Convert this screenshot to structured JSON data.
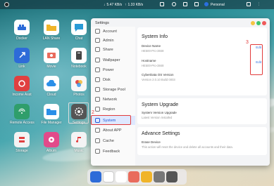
{
  "topbar": {
    "down_speed": "5.47 KB/s",
    "up_speed": "1.33 KB/s",
    "user": "Personal"
  },
  "desktop": {
    "icons": [
      {
        "label": "Docker",
        "icon": "docker-icon",
        "color": "#2d6bd8"
      },
      {
        "label": "LAN Share",
        "icon": "folder-share-icon",
        "color": "#f0b429"
      },
      {
        "label": "Chat",
        "icon": "chat-icon",
        "color": "#2a9bd6"
      },
      {
        "label": "Link",
        "icon": "link-icon",
        "color": "#2d6bd8"
      },
      {
        "label": "Movie",
        "icon": "movie-icon",
        "color": "#e96b5c"
      },
      {
        "label": "Notebook",
        "icon": "notebook-icon",
        "color": "#444"
      },
      {
        "label": "Income Asst",
        "icon": "income-icon",
        "color": "#e04040"
      },
      {
        "label": "Cloud",
        "icon": "cloud-icon",
        "color": "#2a8fe8"
      },
      {
        "label": "Photos",
        "icon": "photos-icon",
        "color": "#f7f7f7"
      },
      {
        "label": "Remote Access",
        "icon": "remote-icon",
        "color": "#2f9e6b"
      },
      {
        "label": "File Manager",
        "icon": "folder-icon",
        "color": "#2a8fe8"
      },
      {
        "label": "Settings",
        "icon": "gear-icon",
        "color": "#555"
      },
      {
        "label": "Storage",
        "icon": "storage-icon",
        "color": "#f3f3f3"
      },
      {
        "label": "Album",
        "icon": "album-icon",
        "color": "#e24a8a"
      },
      {
        "label": "Music",
        "icon": "music-icon",
        "color": "#f4f4f4"
      }
    ]
  },
  "window": {
    "title": "Settings"
  },
  "sidebar": {
    "items": [
      {
        "label": "Account",
        "icon": "account-icon"
      },
      {
        "label": "Admin",
        "icon": "admin-icon"
      },
      {
        "label": "Share",
        "icon": "share-icon"
      },
      {
        "label": "Wallpaper",
        "icon": "wallpaper-icon"
      },
      {
        "label": "Power",
        "icon": "power-icon"
      },
      {
        "label": "Disk",
        "icon": "disk-icon"
      },
      {
        "label": "Storage Pool",
        "icon": "storage-pool-icon"
      },
      {
        "label": "Network",
        "icon": "network-icon"
      },
      {
        "label": "Region",
        "icon": "region-icon"
      },
      {
        "label": "System",
        "icon": "system-icon"
      },
      {
        "label": "About APP",
        "icon": "about-icon"
      },
      {
        "label": "Cache",
        "icon": "cache-icon"
      },
      {
        "label": "Feedback",
        "icon": "feedback-icon"
      }
    ]
  },
  "system_info": {
    "heading": "System Info",
    "device_name_label": "Device Name",
    "device_name_value": "HE500-Pro-3848",
    "hostname_label": "Hostname",
    "hostname_value": "HE500-Pro-3848",
    "os_label": "CyberData OS Version",
    "os_value": "Version 2.0.10  Build 0003",
    "edit_label": "Edit"
  },
  "system_upgrade": {
    "heading": "System Upgrade",
    "label": "System Version Upgrade",
    "value": "Latest Version Installed"
  },
  "advance": {
    "heading": "Advance Settings",
    "label": "Erase Device",
    "value": "This action will reset the device and delete all accounts and their data."
  },
  "annotations": {
    "step2": "2",
    "step3": "3"
  },
  "colors": {
    "accent": "#1f5ad6",
    "annotation": "#e23b3b"
  }
}
